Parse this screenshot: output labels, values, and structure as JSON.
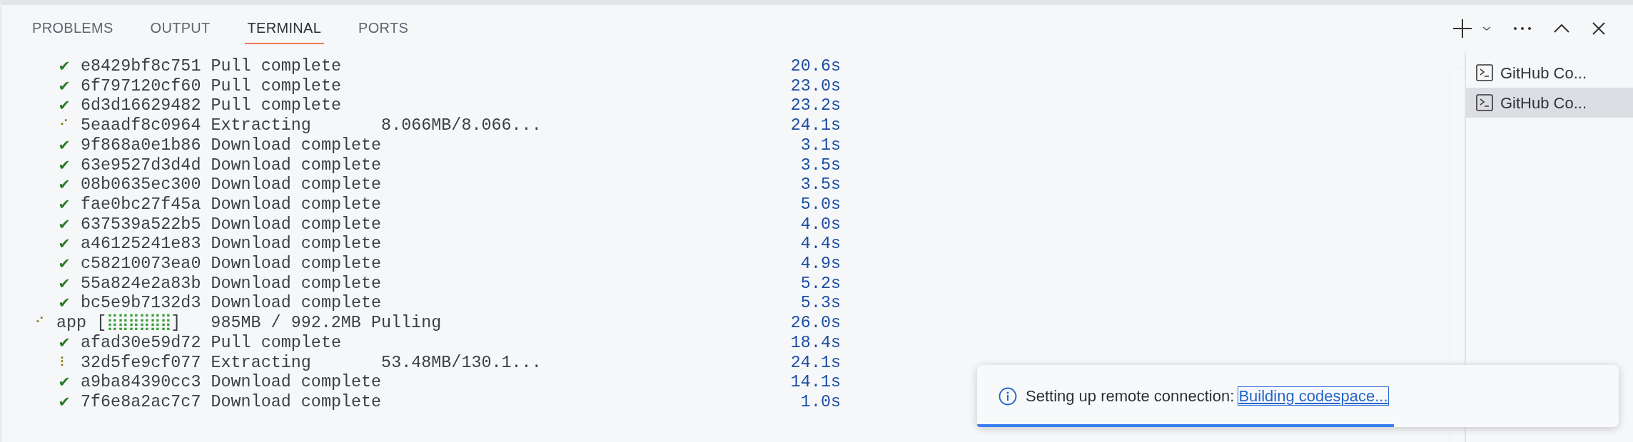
{
  "panel_tabs": [
    {
      "label": "PROBLEMS",
      "selected": false
    },
    {
      "label": "OUTPUT",
      "selected": false
    },
    {
      "label": "TERMINAL",
      "selected": true
    },
    {
      "label": "PORTS",
      "selected": false
    }
  ],
  "terminal_lines": [
    {
      "kind": "layer",
      "done": true,
      "mark": "✔",
      "id": "e8429bf8c751",
      "status": "Pull complete",
      "time": "20.6s"
    },
    {
      "kind": "layer",
      "done": true,
      "mark": "✔",
      "id": "6f797120cf60",
      "status": "Pull complete",
      "time": "23.0s"
    },
    {
      "kind": "layer",
      "done": true,
      "mark": "✔",
      "id": "6d3d16629482",
      "status": "Pull complete",
      "time": "23.2s"
    },
    {
      "kind": "layer",
      "done": false,
      "mark": "⠊",
      "id": "5eaadf8c0964",
      "status": "Extracting",
      "progress": "8.066MB/8.066...",
      "time": "24.1s"
    },
    {
      "kind": "layer",
      "done": true,
      "mark": "✔",
      "id": "9f868a0e1b86",
      "status": "Download complete",
      "time": "3.1s"
    },
    {
      "kind": "layer",
      "done": true,
      "mark": "✔",
      "id": "63e9527d3d4d",
      "status": "Download complete",
      "time": "3.5s"
    },
    {
      "kind": "layer",
      "done": true,
      "mark": "✔",
      "id": "08b0635ec300",
      "status": "Download complete",
      "time": "3.5s"
    },
    {
      "kind": "layer",
      "done": true,
      "mark": "✔",
      "id": "fae0bc27f45a",
      "status": "Download complete",
      "time": "5.0s"
    },
    {
      "kind": "layer",
      "done": true,
      "mark": "✔",
      "id": "637539a522b5",
      "status": "Download complete",
      "time": "4.0s"
    },
    {
      "kind": "layer",
      "done": true,
      "mark": "✔",
      "id": "a46125241e83",
      "status": "Download complete",
      "time": "4.4s"
    },
    {
      "kind": "layer",
      "done": true,
      "mark": "✔",
      "id": "c58210073ea0",
      "status": "Download complete",
      "time": "4.9s"
    },
    {
      "kind": "layer",
      "done": true,
      "mark": "✔",
      "id": "55a824e2a83b",
      "status": "Download complete",
      "time": "5.2s"
    },
    {
      "kind": "layer",
      "done": true,
      "mark": "✔",
      "id": "bc5e9b7132d3",
      "status": "Download complete",
      "time": "5.3s"
    },
    {
      "kind": "image",
      "done": false,
      "mark": "⠊",
      "id": "app",
      "bar_left": "[",
      "bar": "⣿⣿⣿⣿⣿⣿",
      "bar_right": "]",
      "progress": "985MB / 992.2MB",
      "status": "Pulling",
      "time": "26.0s"
    },
    {
      "kind": "layer",
      "done": true,
      "mark": "✔",
      "id": "afad30e59d72",
      "status": "Pull complete",
      "time": "18.4s"
    },
    {
      "kind": "layer",
      "done": false,
      "mark": "⠇",
      "id": "32d5fe9cf077",
      "status": "Extracting",
      "progress": "53.48MB/130.1...",
      "time": "24.1s"
    },
    {
      "kind": "layer",
      "done": true,
      "mark": "✔",
      "id": "a9ba84390cc3",
      "status": "Download complete",
      "time": "14.1s"
    },
    {
      "kind": "layer",
      "done": true,
      "mark": "✔",
      "id": "7f6e8a2ac7c7",
      "status": "Download complete",
      "time": "1.0s"
    }
  ],
  "terminal_tabs": [
    {
      "label": "GitHub Co...",
      "selected": false
    },
    {
      "label": "GitHub Co...",
      "selected": true
    }
  ],
  "notification": {
    "message": "Setting up remote connection:",
    "link": "Building codespace...",
    "level": 0.65
  }
}
